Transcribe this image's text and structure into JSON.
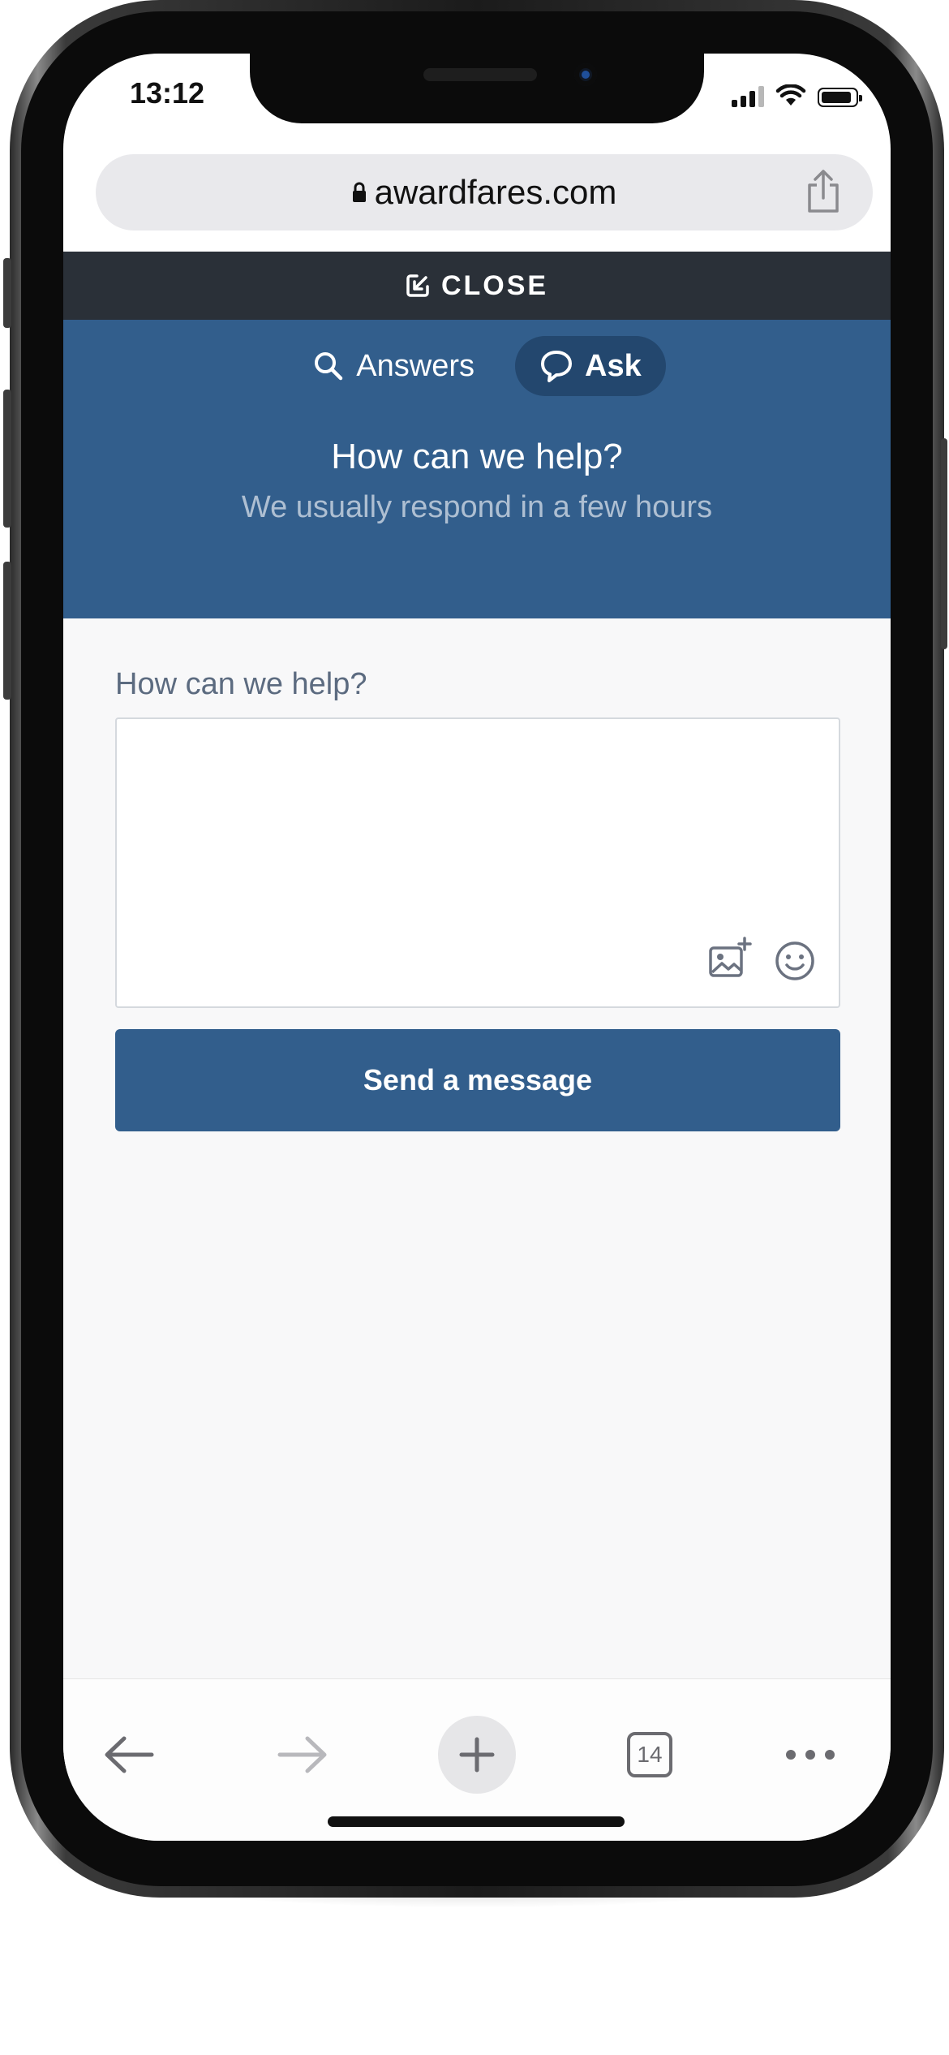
{
  "status_bar": {
    "time": "13:12",
    "icons": [
      "signal-icon",
      "wifi-icon",
      "battery-icon"
    ]
  },
  "browser": {
    "url": "awardfares.com",
    "icons": [
      "lock-icon",
      "share-icon"
    ],
    "toolbar": {
      "tab_count": "14",
      "icons": [
        "back-arrow-icon",
        "forward-arrow-icon",
        "plus-icon",
        "tabs-icon",
        "more-icon"
      ]
    }
  },
  "widget": {
    "close_label": "CLOSE",
    "tabs": [
      {
        "label": "Answers",
        "icon": "search-icon",
        "active": false
      },
      {
        "label": "Ask",
        "icon": "chat-bubble-icon",
        "active": true
      }
    ],
    "header_title": "How can we help?",
    "header_subtitle": "We usually respond in a few hours",
    "form": {
      "field_label": "How can we help?",
      "message_value": "",
      "message_placeholder": "",
      "icons": [
        "add-image-icon",
        "emoji-icon"
      ],
      "send_label": "Send a message"
    }
  },
  "colors": {
    "brand_blue": "#325e8c",
    "active_tab": "#23476e",
    "close_bar": "#2a3038",
    "subtitle": "#aebfd2",
    "page_bg": "#f8f8f9"
  }
}
